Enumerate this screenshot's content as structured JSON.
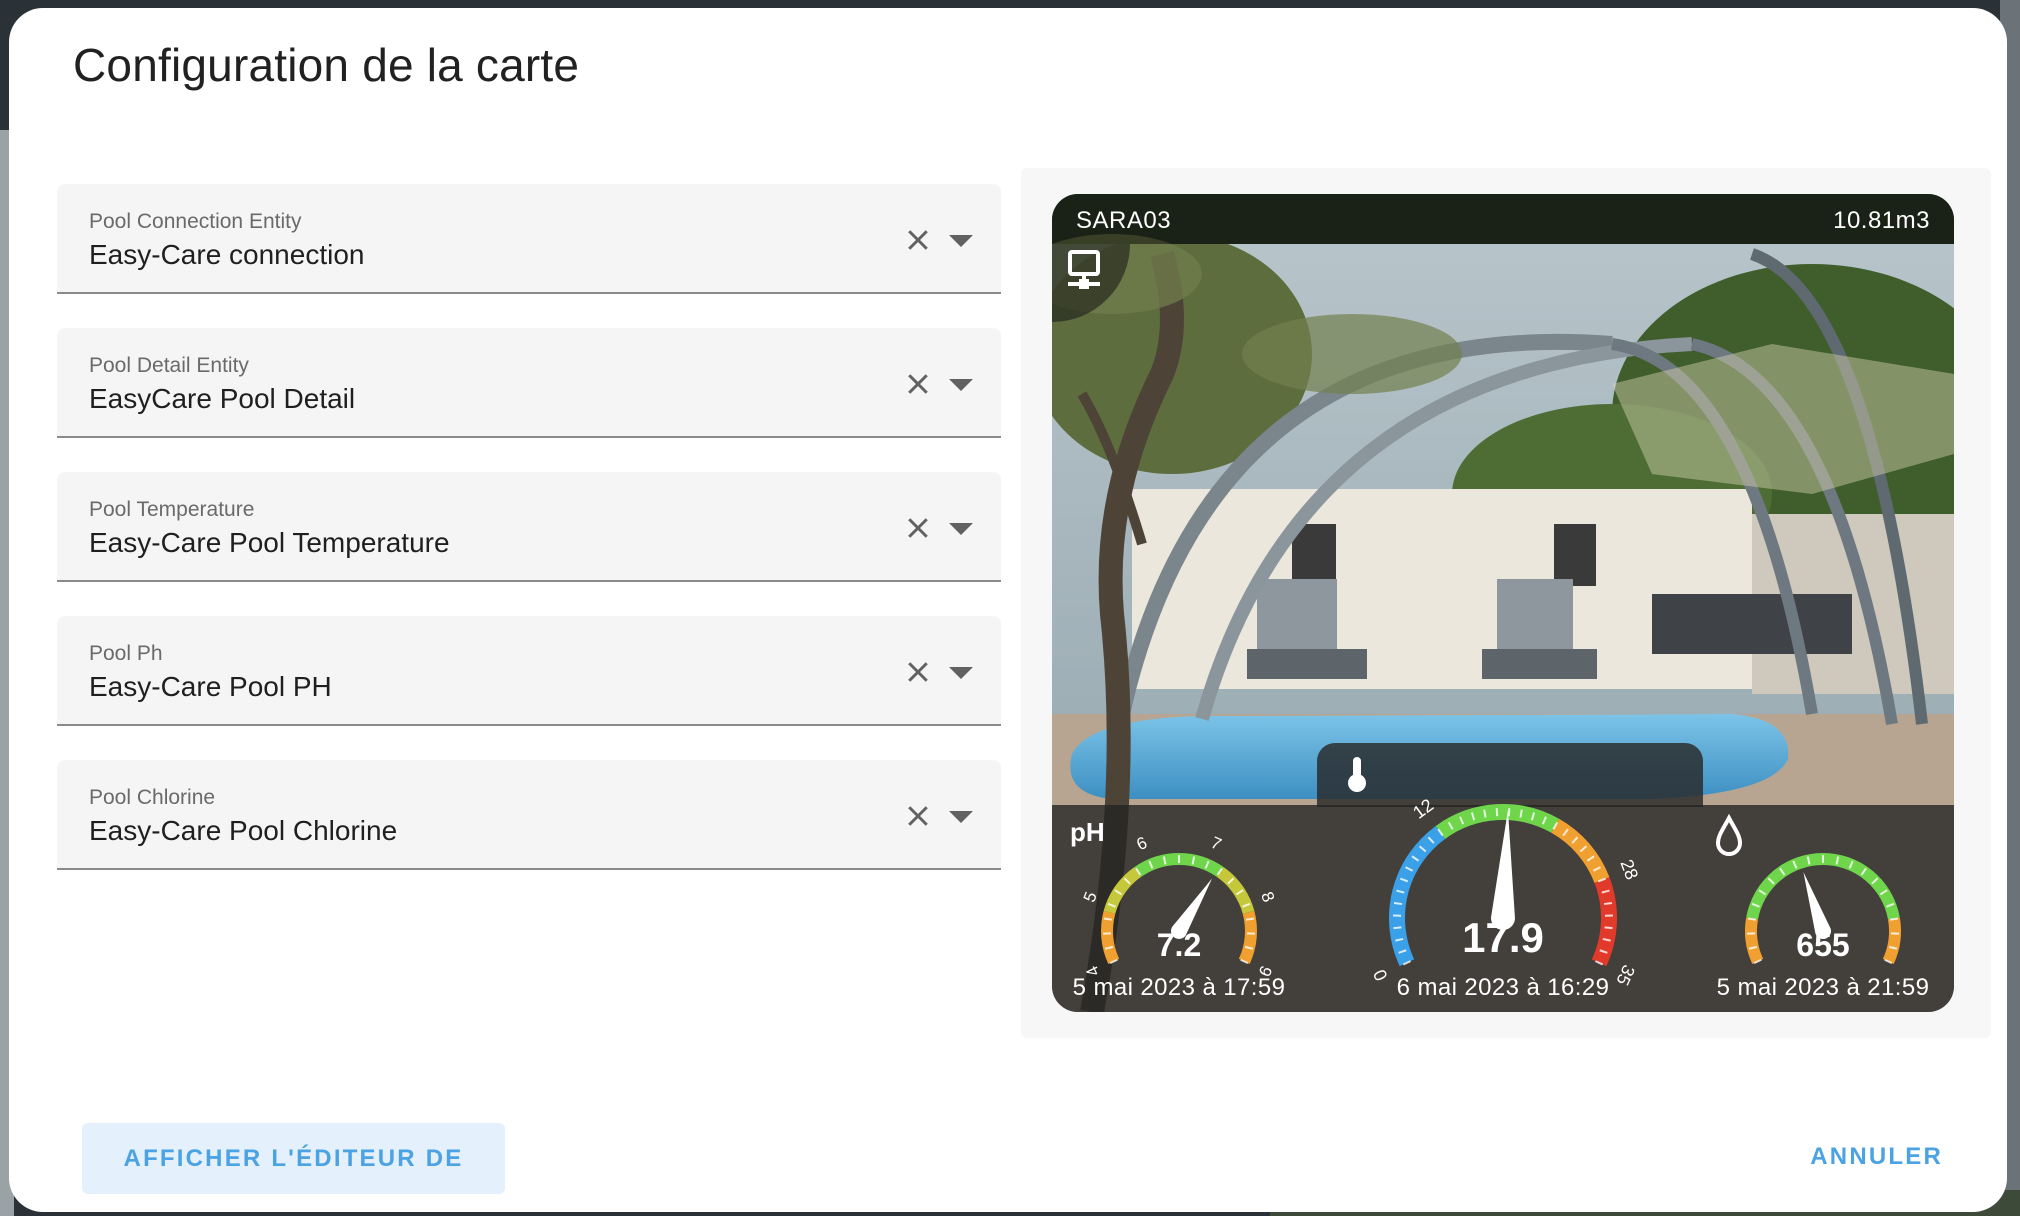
{
  "dialog": {
    "title": "Configuration de la carte"
  },
  "fields": [
    {
      "label": "Pool Connection Entity",
      "value": "Easy-Care connection"
    },
    {
      "label": "Pool Detail Entity",
      "value": "EasyCare Pool Detail"
    },
    {
      "label": "Pool Temperature",
      "value": "Easy-Care Pool Temperature"
    },
    {
      "label": "Pool Ph",
      "value": "Easy-Care Pool PH"
    },
    {
      "label": "Pool Chlorine",
      "value": "Easy-Care Pool Chlorine"
    }
  ],
  "card": {
    "pool_name": "SARA03",
    "volume": "10.81m3",
    "ph": {
      "label": "pH",
      "value": "7.2",
      "date": "5 mai 2023 à 17:59",
      "min": 4,
      "max": 9,
      "ticks": [
        "4",
        "5",
        "6",
        "7",
        "8",
        "9"
      ]
    },
    "temperature": {
      "value": "17.9",
      "date": "6 mai 2023 à 16:29",
      "min": 0,
      "max": 35,
      "ticks": [
        "0",
        "12",
        "28",
        "35"
      ]
    },
    "chlorine": {
      "value": "655",
      "date": "5 mai 2023 à 21:59",
      "needle_fraction": 0.42
    }
  },
  "actions": {
    "code_editor": "AFFICHER L'ÉDITEUR DE CODE",
    "cancel": "ANNULER"
  },
  "colors": {
    "accent": "#4ba3e3",
    "accent_bg": "#e4f0fb",
    "gauge_blue": "#3aa0e8",
    "gauge_green": "#6fd64c",
    "gauge_orange": "#f0a030",
    "gauge_red": "#e23a2a"
  },
  "icons": [
    "close-icon",
    "caret-down-icon",
    "network-icon",
    "thermometer-icon",
    "water-drop-icon"
  ]
}
